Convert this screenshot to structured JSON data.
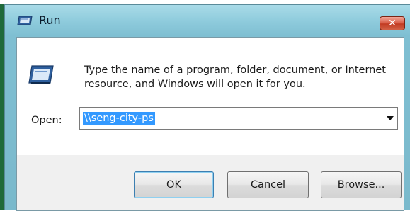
{
  "window": {
    "title": "Run",
    "close_label": "✕"
  },
  "description": "Type the name of a program, folder, document, or Internet resource, and Windows will open it for you.",
  "open": {
    "label": "Open:",
    "value": "\\\\seng-city-ps"
  },
  "buttons": {
    "ok": "OK",
    "cancel": "Cancel",
    "browse": "Browse..."
  },
  "icons": {
    "title": "run-icon",
    "dialog": "run-icon",
    "dropdown": "chevron-down-icon",
    "close": "close-icon"
  },
  "colors": {
    "titlebar": "#8ecbdc",
    "close_button": "#c23b22",
    "selection": "#3399ff",
    "ok_border": "#3c7fb1"
  }
}
